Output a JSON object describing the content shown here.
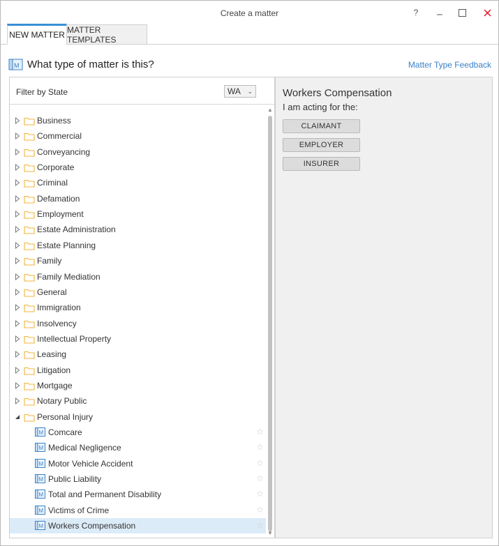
{
  "window": {
    "title": "Create a matter",
    "help_label": "?"
  },
  "tabs": [
    {
      "label": "NEW MATTER",
      "active": true
    },
    {
      "label": "MATTER TEMPLATES",
      "active": false
    }
  ],
  "header": {
    "question": "What type of matter is this?",
    "feedback_link": "Matter Type Feedback"
  },
  "filter": {
    "label": "Filter by State",
    "state_value": "WA"
  },
  "tree": {
    "categories": [
      {
        "label": "Business",
        "expanded": false
      },
      {
        "label": "Commercial",
        "expanded": false
      },
      {
        "label": "Conveyancing",
        "expanded": false
      },
      {
        "label": "Corporate",
        "expanded": false
      },
      {
        "label": "Criminal",
        "expanded": false
      },
      {
        "label": "Defamation",
        "expanded": false
      },
      {
        "label": "Employment",
        "expanded": false
      },
      {
        "label": "Estate Administration",
        "expanded": false
      },
      {
        "label": "Estate Planning",
        "expanded": false
      },
      {
        "label": "Family",
        "expanded": false
      },
      {
        "label": "Family Mediation",
        "expanded": false
      },
      {
        "label": "General",
        "expanded": false
      },
      {
        "label": "Immigration",
        "expanded": false
      },
      {
        "label": "Insolvency",
        "expanded": false
      },
      {
        "label": "Intellectual Property",
        "expanded": false
      },
      {
        "label": "Leasing",
        "expanded": false
      },
      {
        "label": "Litigation",
        "expanded": false
      },
      {
        "label": "Mortgage",
        "expanded": false
      },
      {
        "label": "Notary Public",
        "expanded": false
      },
      {
        "label": "Personal Injury",
        "expanded": true
      }
    ],
    "children": [
      {
        "label": "Comcare",
        "selected": false
      },
      {
        "label": "Medical Negligence",
        "selected": false
      },
      {
        "label": "Motor Vehicle Accident",
        "selected": false
      },
      {
        "label": "Public Liability",
        "selected": false
      },
      {
        "label": "Total and Permanent Disability",
        "selected": false
      },
      {
        "label": "Victims of Crime",
        "selected": false
      },
      {
        "label": "Workers Compensation",
        "selected": true
      }
    ]
  },
  "detail": {
    "title": "Workers Compensation",
    "subtitle": "I am acting for the:",
    "roles": [
      "CLAIMANT",
      "EMPLOYER",
      "INSURER"
    ]
  },
  "colors": {
    "accent": "#3a8fd6",
    "link": "#3a80c8",
    "folder": "#f0b43a",
    "close": "#e81123",
    "selected_row": "#dcebf8"
  },
  "icons": {
    "folder": "folder-icon",
    "matter_type": "matter-type-icon",
    "favorite": "star-icon"
  }
}
